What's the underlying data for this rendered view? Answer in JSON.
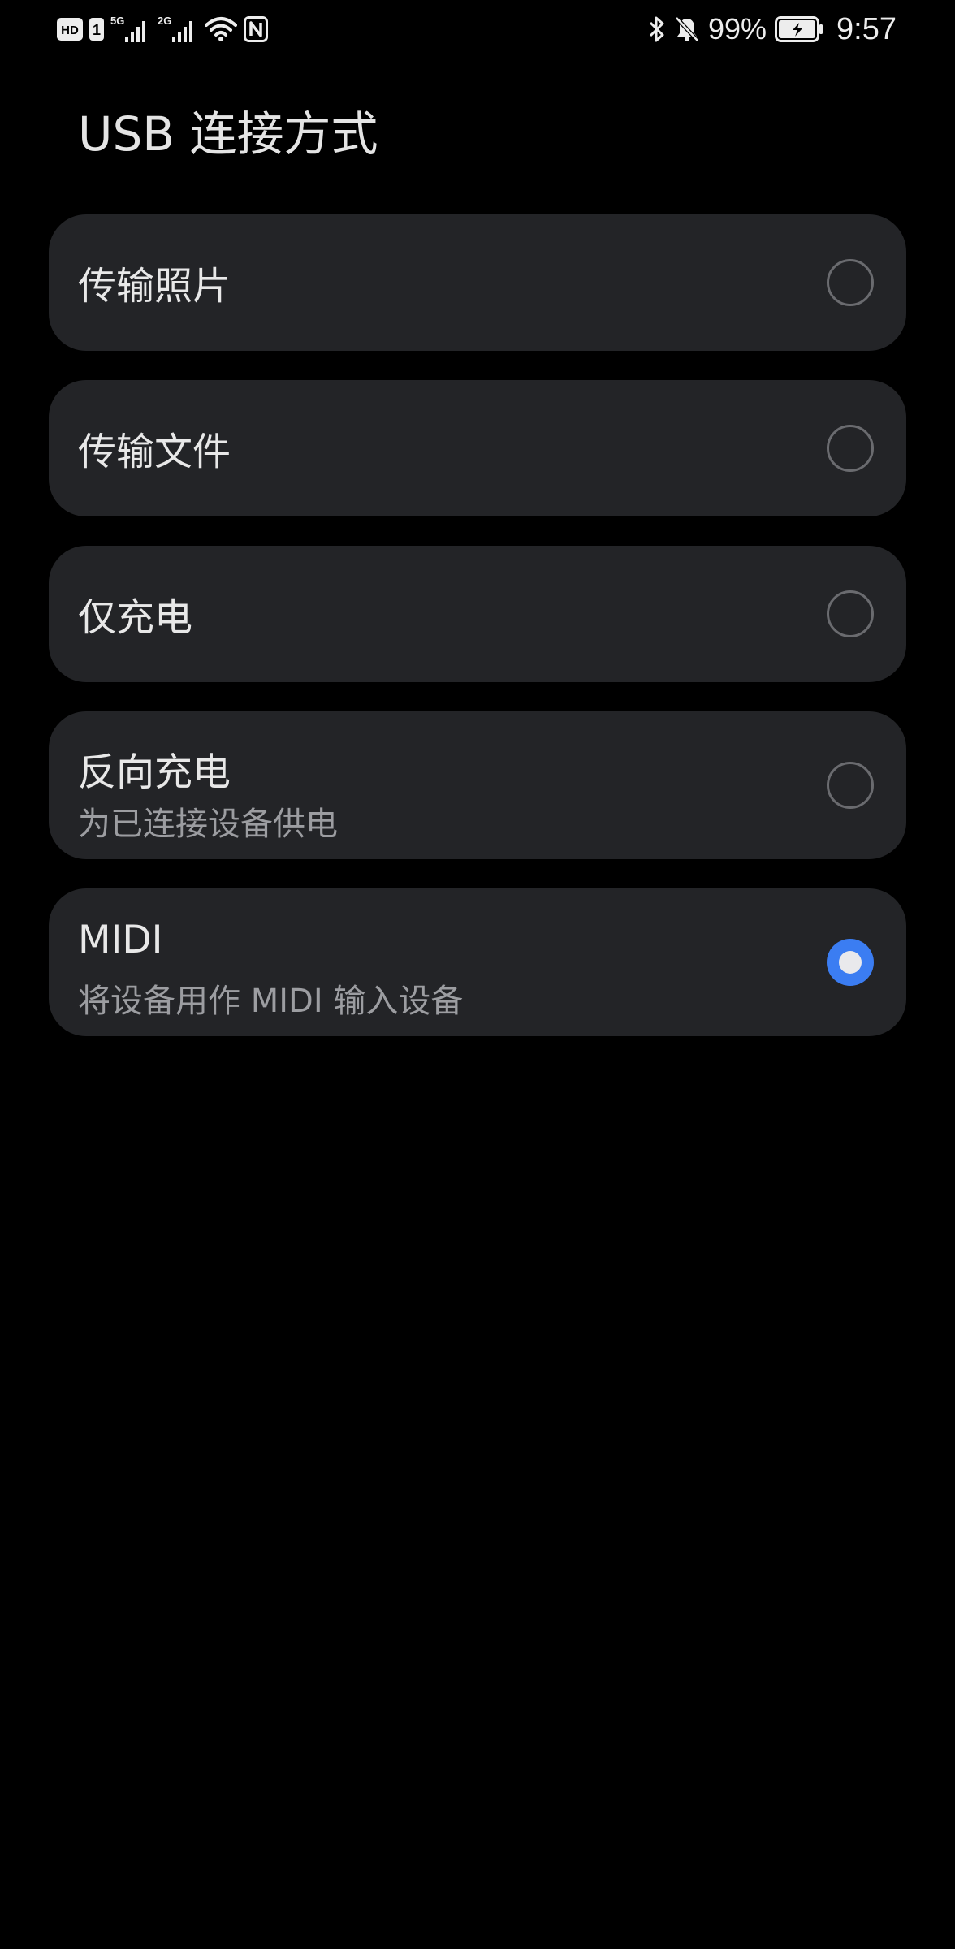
{
  "status_bar": {
    "hd_label": "HD",
    "sim_label": "1",
    "network1": "5G",
    "network2": "2G",
    "battery_percent": "99%",
    "time": "9:57",
    "icons": [
      "hd-icon",
      "sim-1-icon",
      "signal-5g-icon",
      "signal-2g-icon",
      "wifi-icon",
      "nfc-icon",
      "bluetooth-icon",
      "mute-bell-icon",
      "battery-charging-icon"
    ]
  },
  "title": "USB 连接方式",
  "options": [
    {
      "label": "传输照片",
      "subtitle": "",
      "selected": false
    },
    {
      "label": "传输文件",
      "subtitle": "",
      "selected": false
    },
    {
      "label": "仅充电",
      "subtitle": "",
      "selected": false
    },
    {
      "label": "反向充电",
      "subtitle": "为已连接设备供电",
      "selected": false
    },
    {
      "label": "MIDI",
      "subtitle": "将设备用作 MIDI 输入设备",
      "selected": true
    }
  ],
  "colors": {
    "background": "#000000",
    "card": "#232427",
    "accent": "#3b7df2",
    "primary_text": "#e8e8e8",
    "secondary_text": "#9c9da1"
  }
}
